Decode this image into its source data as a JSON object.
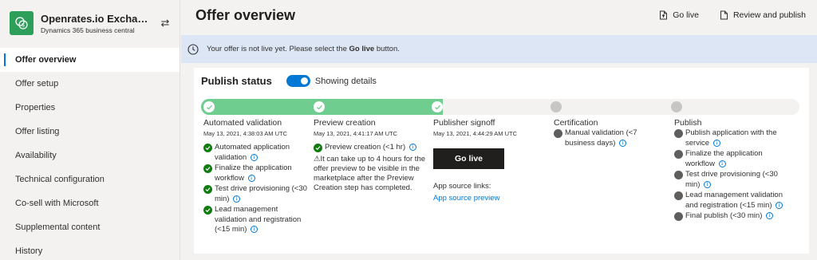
{
  "app": {
    "title": "Openrates.io Exchang…",
    "subtitle": "Dynamics 365 business central",
    "logo_color": "#2e9e5b"
  },
  "sidebar": {
    "items": [
      {
        "label": "Offer overview",
        "active": true
      },
      {
        "label": "Offer setup"
      },
      {
        "label": "Properties"
      },
      {
        "label": "Offer listing"
      },
      {
        "label": "Availability"
      },
      {
        "label": "Technical configuration"
      },
      {
        "label": "Co-sell with Microsoft"
      },
      {
        "label": "Supplemental content"
      },
      {
        "label": "History"
      }
    ]
  },
  "header": {
    "title": "Offer overview",
    "go_live": "Go live",
    "review_publish": "Review and publish"
  },
  "banner": {
    "text_before": "Your offer is not live yet. Please select the ",
    "text_bold": "Go live",
    "text_after": " button."
  },
  "publish_status": {
    "title": "Publish status",
    "toggle_label": "Showing details",
    "progress_completed_stages": 3,
    "stages": [
      {
        "name": "Automated validation",
        "time": "May 13, 2021, 4:38:03 AM UTC",
        "steps": [
          {
            "text": "Automated application validation",
            "status": "done"
          },
          {
            "text": "Finalize the application workflow",
            "status": "done"
          },
          {
            "text": "Test drive provisioning (<30 min)",
            "status": "done"
          },
          {
            "text": "Lead management validation and registration (<15 min)",
            "status": "done"
          }
        ]
      },
      {
        "name": "Preview creation",
        "time": "May 13, 2021, 4:41:17 AM UTC",
        "steps": [
          {
            "text": "Preview creation (<1 hr)",
            "status": "done"
          }
        ],
        "note": "⚠It can take up to 4 hours for the offer preview to be visible in the marketplace after the Preview Creation step has completed."
      },
      {
        "name": "Publisher signoff",
        "time": "May 13, 2021, 4:44:29 AM UTC",
        "button": "Go live",
        "links_label": "App source links:",
        "link": "App source preview"
      },
      {
        "name": "Certification",
        "steps": [
          {
            "text": "Manual validation (<7 business days)",
            "status": "pending"
          }
        ]
      },
      {
        "name": "Publish",
        "steps": [
          {
            "text": "Publish application with the service",
            "status": "pending"
          },
          {
            "text": "Finalize the application workflow",
            "status": "pending"
          },
          {
            "text": "Test drive provisioning (<30 min)",
            "status": "pending"
          },
          {
            "text": "Lead management validation and registration (<15 min)",
            "status": "pending"
          },
          {
            "text": "Final publish (<30 min)",
            "status": "pending"
          }
        ]
      }
    ]
  },
  "colors": {
    "accent": "#0078d4",
    "success": "#107c10",
    "progress_fill": "#6fce8f",
    "banner_bg": "#dde6f4"
  }
}
